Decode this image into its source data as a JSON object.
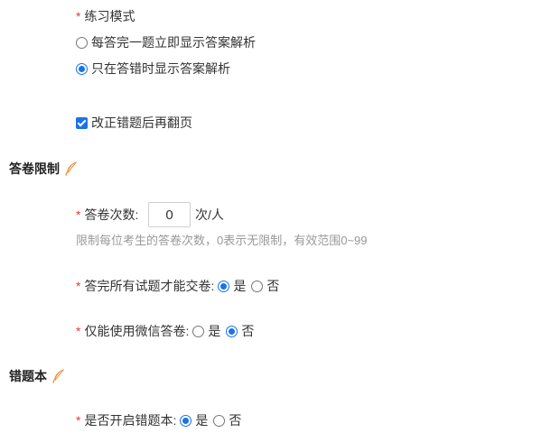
{
  "practice_mode": {
    "label": "练习模式",
    "options": [
      {
        "label": "每答完一题立即显示答案解析",
        "checked": false
      },
      {
        "label": "只在答错时显示答案解析",
        "checked": true
      }
    ],
    "page_turn_checkbox": {
      "label": "改正错题后再翻页",
      "checked": true
    }
  },
  "answer_limit_section": {
    "title": "答卷限制",
    "icon": "feather-edit-icon",
    "count": {
      "label": "答卷次数:",
      "value": "0",
      "unit": "次/人",
      "hint": "限制每位考生的答卷次数，0表示无限制，有效范围0~99"
    },
    "require_all": {
      "label": "答完所有试题才能交卷:",
      "yes": "是",
      "no": "否",
      "selected": "yes"
    },
    "wechat_only": {
      "label": "仅能使用微信答卷:",
      "yes": "是",
      "no": "否",
      "selected": "no"
    }
  },
  "wrong_book_section": {
    "title": "错题本",
    "icon": "feather-edit-icon",
    "enable": {
      "label": "是否开启错题本:",
      "yes": "是",
      "no": "否",
      "selected": "yes"
    }
  },
  "colors": {
    "required_star": "#e33e33",
    "accent": "#1a73e8",
    "icon_orange": "#f08a24",
    "hint": "#999999"
  }
}
